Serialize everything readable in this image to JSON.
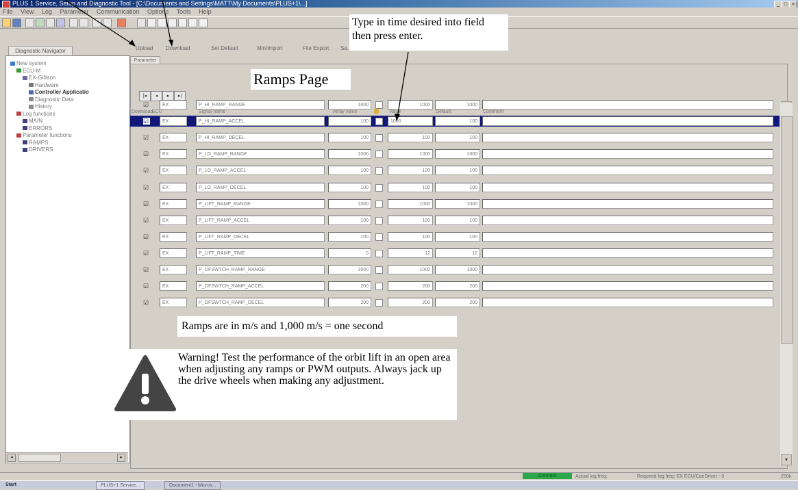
{
  "window": {
    "title": "PLUS 1 Service, Setup and Diagnostic Tool - [C:\\Documents and Settings\\MATT\\My Documents\\PLUS+1\\...]",
    "controls": [
      "_",
      "□",
      "×"
    ]
  },
  "menu": [
    "File",
    "View",
    "Log",
    "Parameter",
    "Communication",
    "Options",
    "Tools",
    "Help"
  ],
  "nav": {
    "tab_label": "Diagnostic Navigator",
    "tree": [
      {
        "label": "New system",
        "icon": "system-icon",
        "level": 0,
        "bold": false
      },
      {
        "label": "ECU-M",
        "icon": "ecu-icon",
        "level": 1,
        "bold": false
      },
      {
        "label": "EX-Gillison",
        "icon": "device-icon",
        "level": 2,
        "bold": false
      },
      {
        "label": "Hardware",
        "icon": "hardware-icon",
        "level": 3,
        "bold": false
      },
      {
        "label": "Controller Applicatio",
        "icon": "app-icon",
        "level": 3,
        "bold": true
      },
      {
        "label": "Diagnostic Data",
        "icon": "data-icon",
        "level": 3,
        "bold": false
      },
      {
        "label": "History",
        "icon": "history-icon",
        "level": 3,
        "bold": false
      },
      {
        "label": "Log functions",
        "icon": "folder-icon",
        "level": 1,
        "bold": false
      },
      {
        "label": "MAIN",
        "icon": "item-icon",
        "level": 2,
        "bold": false
      },
      {
        "label": "ERRORS",
        "icon": "item-icon",
        "level": 2,
        "bold": false
      },
      {
        "label": "Parameter functions",
        "icon": "folder-icon",
        "level": 1,
        "bold": false
      },
      {
        "label": "RAMPS",
        "icon": "item-icon",
        "level": 2,
        "bold": false
      },
      {
        "label": "DRIVERS",
        "icon": "item-icon",
        "level": 2,
        "bold": false
      }
    ]
  },
  "function_toolbar": [
    "Upload",
    "Download",
    "Set Default",
    "Min/Import",
    "File Export",
    "Sa..."
  ],
  "parameter_tab": "Parameter list",
  "table": {
    "nav_buttons": [
      "|◂",
      "◂",
      "▸",
      "▸|"
    ],
    "headers": [
      "Download",
      "ECU",
      "Signal name",
      "Array value",
      "",
      "Value",
      "Default",
      "Comment"
    ],
    "rows": [
      {
        "checked": true,
        "ecu": "EX",
        "signal": "P_HI_RAMP_RANGE",
        "array": "1000",
        "value": "1000",
        "default": "1000",
        "selected": false
      },
      {
        "checked": true,
        "ecu": "EX",
        "signal": "P_HI_RAMP_ACCEL",
        "array": "100",
        "value": "1000",
        "default": "100",
        "selected": true
      },
      {
        "checked": true,
        "ecu": "EX",
        "signal": "P_HI_RAMP_DECEL",
        "array": "100",
        "value": "100",
        "default": "100",
        "selected": false
      },
      {
        "checked": true,
        "ecu": "EX",
        "signal": "P_LO_RAMP_RANGE",
        "array": "1000",
        "value": "1000",
        "default": "1000",
        "selected": false
      },
      {
        "checked": true,
        "ecu": "EX",
        "signal": "P_LO_RAMP_ACCEL",
        "array": "100",
        "value": "100",
        "default": "100",
        "selected": false
      },
      {
        "checked": true,
        "ecu": "EX",
        "signal": "P_LO_RAMP_DECEL",
        "array": "100",
        "value": "100",
        "default": "100",
        "selected": false
      },
      {
        "checked": true,
        "ecu": "EX",
        "signal": "P_LIFT_RAMP_RANGE",
        "array": "1000",
        "value": "1000",
        "default": "1000",
        "selected": false
      },
      {
        "checked": true,
        "ecu": "EX",
        "signal": "P_LIFT_RAMP_ACCEL",
        "array": "100",
        "value": "100",
        "default": "100",
        "selected": false
      },
      {
        "checked": true,
        "ecu": "EX",
        "signal": "P_LIFT_RAMP_DECEL",
        "array": "100",
        "value": "100",
        "default": "100",
        "selected": false
      },
      {
        "checked": true,
        "ecu": "EX",
        "signal": "P_LIFT_RAMP_TIME",
        "array": "0",
        "value": "12",
        "default": "12",
        "selected": false
      },
      {
        "checked": true,
        "ecu": "EX",
        "signal": "P_OFSWTCH_RAMP_RANGE",
        "array": "1000",
        "value": "1000",
        "default": "1000",
        "selected": false
      },
      {
        "checked": true,
        "ecu": "EX",
        "signal": "P_OFSWTCH_RAMP_ACCEL",
        "array": "200",
        "value": "200",
        "default": "200",
        "selected": false
      },
      {
        "checked": true,
        "ecu": "EX",
        "signal": "P_OFSWTCH_RAMP_DECEL",
        "array": "200",
        "value": "200",
        "default": "200",
        "selected": false
      }
    ]
  },
  "annotations": {
    "callout_top": "Type in time desired into field then press enter.",
    "page_title": "Ramps Page",
    "ramps_note": "Ramps are in m/s and 1,000 m/s = one second",
    "warning": "Warning! Test the performance of the orbit lift  in an open area when adjusting any ramps or PWM outputs. Always jack up the drive wheels when making any adjustment."
  },
  "status": {
    "connected": "Connect",
    "actual_freq": "Actual log freq:",
    "required_freq": "Required log freq:  EX ECU/CanDriver - 0",
    "right": "250k"
  },
  "taskbar": {
    "start": "Start",
    "items": [
      "PLUS+1 Service...",
      "Document1 - Micros..."
    ]
  },
  "colors": {
    "selection": "#11187a",
    "connected": "#2aa84a",
    "titlebar": "#0a246a"
  }
}
